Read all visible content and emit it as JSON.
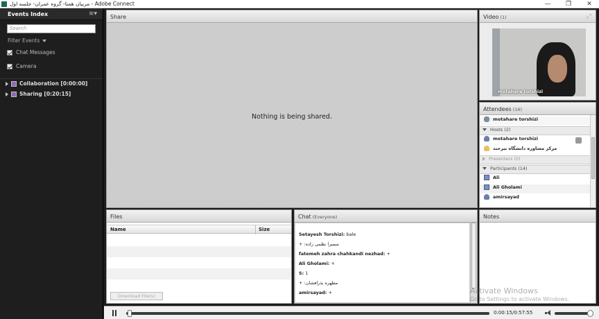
{
  "window": {
    "title": "مربیان همتا- گروه عمران- جلسه اول - Adobe Connect",
    "controls": [
      "—",
      "❐",
      "✕"
    ]
  },
  "events_index": {
    "title": "Events Index",
    "menu_icon": "≡▾",
    "search_placeholder": "Search",
    "filter_label": "Filter Events",
    "checks": [
      {
        "label": "Chat Messages",
        "checked": true
      },
      {
        "label": "Camera",
        "checked": true
      }
    ],
    "events": [
      {
        "label": "Collaboration [0:00:00]"
      },
      {
        "label": "Sharing [0:20:15]"
      }
    ]
  },
  "share": {
    "title": "Share",
    "empty_text": "Nothing is being shared."
  },
  "video": {
    "title": "Video",
    "count": "(1)",
    "camera_name": "motahare torshizi"
  },
  "attendees": {
    "title": "Attendees",
    "count": "(16)",
    "phone_user": "motahare torshizi",
    "groups": {
      "hosts": "Hosts (2)",
      "presenters": "Presenters (0)",
      "participants": "Participants (14)"
    },
    "hosts": [
      "motahare torshizi",
      "مرکز مشاوره دانشگاه بیرجند"
    ],
    "participants": [
      "Ali",
      "Ali Gholami",
      "amirsayad"
    ]
  },
  "files": {
    "title": "Files",
    "col_name": "Name",
    "col_size": "Size",
    "download_label": "Download File(s)"
  },
  "chat": {
    "title": "Chat",
    "scope": "(Everyone)",
    "messages": [
      {
        "sender": "Setayesh Torshizi:",
        "text": "bale"
      },
      {
        "sender": "",
        "text": "+ :سمیرا نظمی زاده"
      },
      {
        "sender": "fatemeh zahra chahkandi nezhad:",
        "text": "+"
      },
      {
        "sender": "Ali Gholami:",
        "text": "+"
      },
      {
        "sender": "S:",
        "text": "1"
      },
      {
        "sender": "",
        "text": "+ :مطهره بذرافشان"
      },
      {
        "sender": "amirsayad:",
        "text": "+"
      }
    ]
  },
  "notes": {
    "title": "Notes"
  },
  "playback": {
    "time": "0:00:15/0:57:55",
    "progress": 0.0043,
    "volume": 1.0
  },
  "watermark": {
    "line1": "Activate Windows",
    "line2": "Go to Settings to activate Windows."
  }
}
